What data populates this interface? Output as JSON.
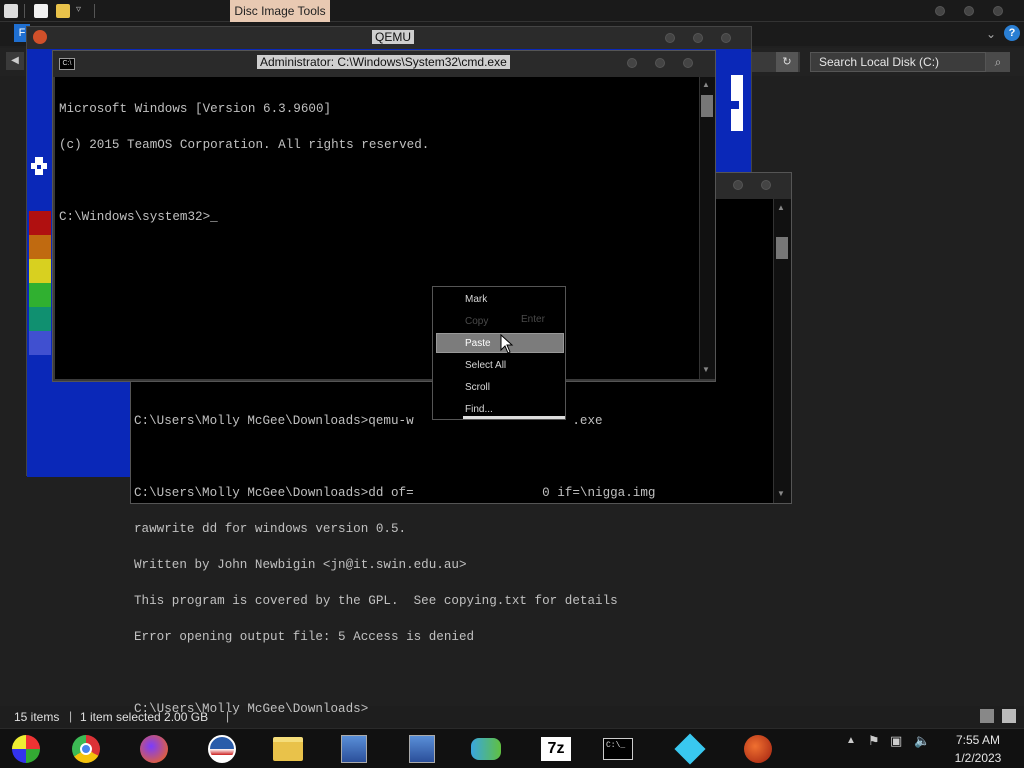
{
  "explorer": {
    "contextual_tab": "Disc Image Tools",
    "ribbon_file": "F",
    "search_placeholder": "Search Local Disk (C:)",
    "status_items": "15 items",
    "status_selected": "1 item selected  2.00 GB",
    "help": "?"
  },
  "qemu": {
    "title": "QEMU"
  },
  "cmd_admin": {
    "title": "Administrator: C:\\Windows\\System32\\cmd.exe",
    "icon_label": "C:\\",
    "lines": [
      "Microsoft Windows [Version 6.3.9600]",
      "(c) 2015 TeamOS Corporation. All rights reserved.",
      "",
      "C:\\Windows\\system32>_"
    ]
  },
  "cmd_guest": {
    "lines": [
      "C:\\Users\\Molly McGee\\Downloads>qemu-w                     .exe",
      "",
      "C:\\Users\\Molly McGee\\Downloads>dd of=                 0 if=\\nigga.img",
      "rawwrite dd for windows version 0.5.",
      "Written by John Newbigin <jn@it.swin.edu.au>",
      "This program is covered by the GPL.  See copying.txt for details",
      "Error opening output file: 5 Access is denied",
      "",
      "C:\\Users\\Molly McGee\\Downloads>"
    ]
  },
  "context_menu": {
    "items": [
      {
        "label": "Mark",
        "enabled": true
      },
      {
        "label": "Copy",
        "enabled": false,
        "shortcut": "Enter"
      },
      {
        "label": "Paste",
        "enabled": true,
        "highlighted": true
      },
      {
        "label": "Select All",
        "enabled": true
      },
      {
        "label": "Scroll",
        "enabled": true
      },
      {
        "label": "Find...",
        "enabled": true
      }
    ]
  },
  "taskbar": {
    "apps": [
      {
        "name": "Windows Live / DVD",
        "icon": "shield-cd-icon"
      },
      {
        "name": "Google Chrome",
        "icon": "chrome-icon"
      },
      {
        "name": "Firefox",
        "icon": "firefox-icon"
      },
      {
        "name": "Obama",
        "icon": "obama-logo-icon"
      },
      {
        "name": "File Explorer",
        "icon": "folder-icon"
      },
      {
        "name": "Setup",
        "icon": "installer-icon"
      },
      {
        "name": "Setup 2",
        "icon": "installer-icon"
      },
      {
        "name": "Network",
        "icon": "network-people-icon"
      },
      {
        "name": "7-Zip",
        "icon": "7z-icon",
        "text": "7z"
      },
      {
        "name": "Command Prompt",
        "icon": "cmd-icon",
        "text": "C:\\_"
      },
      {
        "name": "Diamond",
        "icon": "diamond-icon"
      },
      {
        "name": "QEMU",
        "icon": "qemu-icon"
      }
    ],
    "time": "7:55 AM",
    "date": "1/2/2023"
  },
  "colors": {
    "qemu_screen": "#0a28b8",
    "contextual_tab": "#e8c9b2",
    "menu_highlight": "#7c7c7c"
  }
}
